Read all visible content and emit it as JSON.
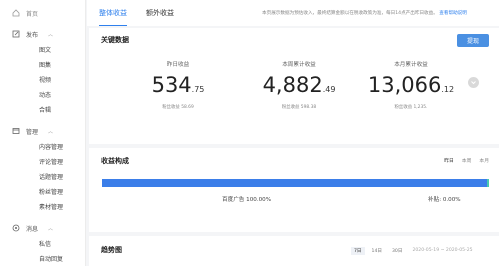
{
  "sidebar": {
    "home": "首页",
    "sections": [
      {
        "label": "发布",
        "icon": "edit-icon",
        "items": [
          "图文",
          "图集",
          "视频",
          "动态",
          "合辑"
        ]
      },
      {
        "label": "管理",
        "icon": "folder-icon",
        "items": [
          "内容管理",
          "评论管理",
          "话题管理",
          "粉丝管理",
          "素材管理"
        ]
      },
      {
        "label": "消息",
        "icon": "bell-icon",
        "items": [
          "私信",
          "自动回复"
        ]
      }
    ]
  },
  "tabs": {
    "overall": "整体收益",
    "extra": "额外收益"
  },
  "notice": {
    "text": "本页展示数据为预估收入，最终结算金额以在税收政策为准，每日14点产出昨日收益。",
    "link": "查看帮助说明"
  },
  "key_data": {
    "title": "关键数据",
    "refresh": "提现",
    "stats": [
      {
        "label": "昨日收益",
        "int": "534",
        "dec": ".75",
        "sub": "粉丝收益 58.69"
      },
      {
        "label": "本周累计收益",
        "int": "4,882",
        "dec": ".49",
        "sub": "粉丝收益 598.38"
      },
      {
        "label": "本月累计收益",
        "int": "13,066",
        "dec": ".12",
        "sub": "粉丝收益 1,235."
      }
    ]
  },
  "composition": {
    "title": "收益构成",
    "periods": [
      "昨日",
      "本周",
      "本月"
    ],
    "active_period": "昨日",
    "ad_label": "百度广告 100.00%",
    "ad_share": 1.0,
    "other_label": "补贴: 0.00%",
    "bar_color": "#3b7ee9"
  },
  "trend": {
    "title": "趋势图",
    "ranges": [
      "7日",
      "14日",
      "30日"
    ],
    "active_range": "7日",
    "date_range": "2020-05-19 ~ 2020-05-25"
  },
  "colors": {
    "accent": "#2f80ed"
  }
}
